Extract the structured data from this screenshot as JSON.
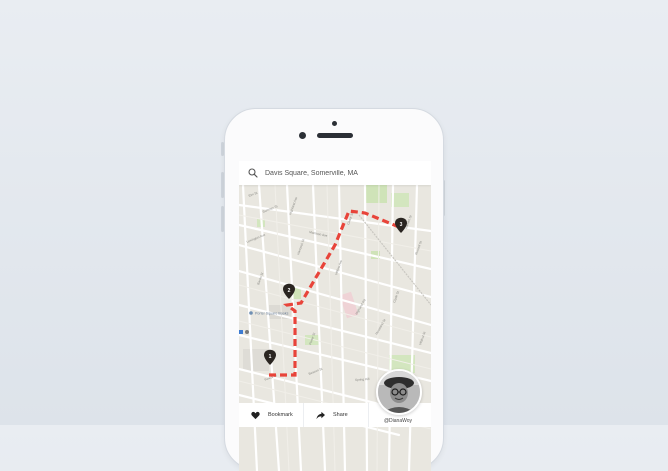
{
  "search": {
    "value": "Davis Square, Somerville, MA",
    "icon": "search-icon"
  },
  "map": {
    "pins": [
      {
        "label": "1"
      },
      {
        "label": "2"
      },
      {
        "label": "3"
      }
    ],
    "route_color": "#e8443a",
    "place_label": "Porter Square Books",
    "streets": [
      "Elm St",
      "Highland Ave",
      "Summer St",
      "Cedar St",
      "Morrison Ave",
      "Willow Ave",
      "Lexington Ave",
      "Hancock St",
      "Highland Rd",
      "Mossland St",
      "Russell St",
      "Banks St",
      "Porter St",
      "Beacon St",
      "Forest St",
      "Hamlet St",
      "Clyde St",
      "Walnut St",
      "Spring Hill"
    ]
  },
  "actions": {
    "bookmark_label": "Bookmark",
    "share_label": "Share"
  },
  "user": {
    "handle": "@DianaWoy"
  }
}
